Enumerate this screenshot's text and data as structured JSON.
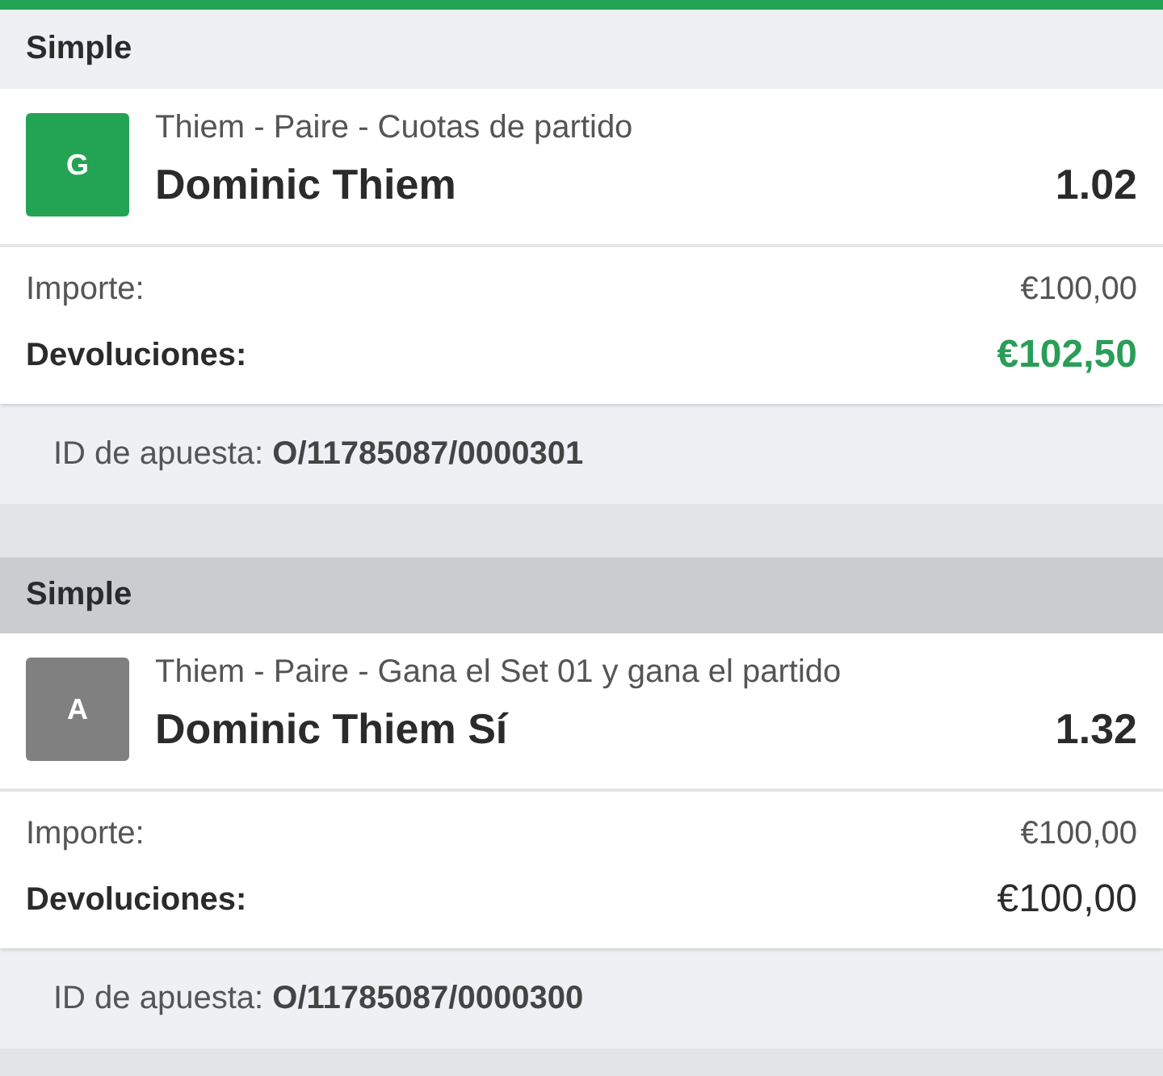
{
  "bets": [
    {
      "type": "Simple",
      "won": true,
      "badge": "G",
      "market": "Thiem - Paire - Cuotas de partido",
      "selection": "Dominic Thiem",
      "odds": "1.02",
      "stake_label": "Importe:",
      "stake": "€100,00",
      "return_label": "Devoluciones:",
      "return": "€102,50",
      "bet_id": "ID de apuesta: **O/11785087/0000301**"
    },
    {
      "type": "Simple",
      "won": false,
      "badge": "A",
      "market": "Thiem - Paire - Gana el Set 01 y gana el partido",
      "selection": "Dominic Thiem Sí",
      "odds": "1.32",
      "stake_label": "Importe:",
      "stake": "€100,00",
      "return_label": "Devoluciones:",
      "return": "€100,00",
      "bet_id": "ID de apuesta: **O/11785087/0000300**"
    }
  ]
}
